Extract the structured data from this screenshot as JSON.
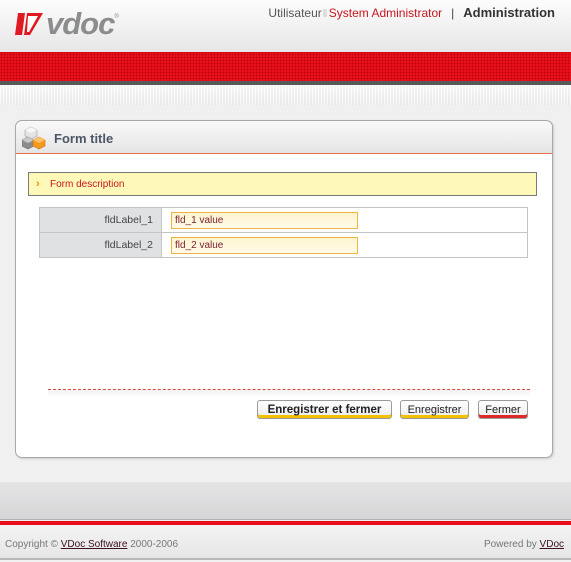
{
  "header": {
    "logo_text": "vdoc",
    "logo_reg": "®",
    "user_label": "Utilisateur",
    "user_name": "System Administrator",
    "separator": "|",
    "admin_link": "Administration"
  },
  "form": {
    "title": "Form title",
    "description_arrow": "›",
    "description": "Form description",
    "fields": [
      {
        "label": "fldLabel_1",
        "value": "fld_1 value"
      },
      {
        "label": "fldLabel_2",
        "value": "fld_2 value"
      }
    ],
    "buttons": {
      "save_close": "Enregistrer et fermer",
      "save": "Enregistrer",
      "close": "Fermer"
    }
  },
  "footer": {
    "copyright_prefix": "Copyright © ",
    "copyright_link": "VDoc Software",
    "copyright_years": " 2000-2006",
    "powered_prefix": "Powered by ",
    "powered_link": "VDoc"
  },
  "colors": {
    "brand_red": "#e8101a",
    "user_name": "#c8161d",
    "description_bg": "#fff9b9",
    "input_border": "#ecb53f"
  }
}
